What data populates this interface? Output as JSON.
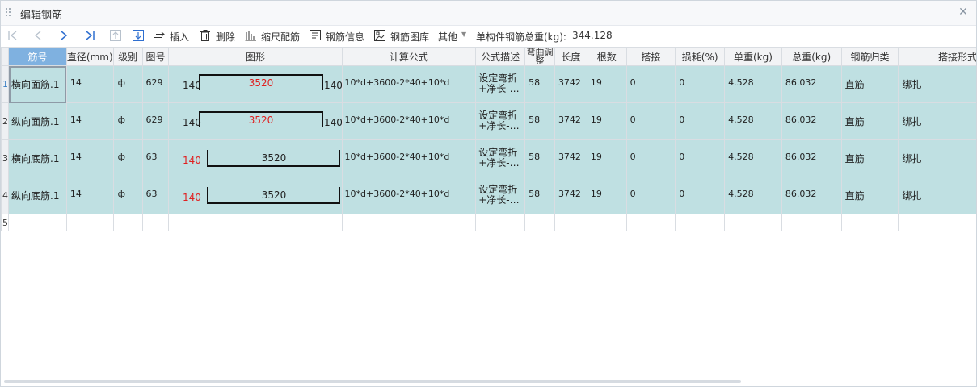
{
  "window": {
    "title": "编辑钢筋",
    "close_icon": "close-icon"
  },
  "toolbar": {
    "first_icon": "first-page-icon",
    "prev_icon": "prev-icon",
    "next_icon": "next-icon",
    "last_icon": "last-page-icon",
    "move_up_icon": "move-up-icon",
    "move_down_icon": "move-down-icon",
    "insert_label": "插入",
    "delete_label": "删除",
    "scale_label": "缩尺配筋",
    "info_label": "钢筋信息",
    "library_label": "钢筋图库",
    "other_label": "其他",
    "total_weight_label": "单构件钢筋总重(kg):",
    "total_weight_value": "344.128"
  },
  "table": {
    "headers": [
      "筋号",
      "直径(mm)",
      "级别",
      "图号",
      "图形",
      "计算公式",
      "公式描述",
      "弯曲调整",
      "长度",
      "根数",
      "搭接",
      "损耗(%)",
      "单重(kg)",
      "总重(kg)",
      "钢筋归类",
      "搭接形式"
    ],
    "rows": [
      {
        "num": "1",
        "name": "横向面筋.1",
        "diameter": "14",
        "grade": "ф",
        "fig_no": "629",
        "shape_left": "140",
        "shape_mid": "3520",
        "shape_right": "140",
        "formula": "10*d+3600-2*40+10*d",
        "desc_line1": "设定弯折",
        "desc_line2": "+净长-…",
        "bend_adj": "58",
        "length": "3742",
        "count": "19",
        "lap": "0",
        "loss": "0",
        "unit_weight": "4.528",
        "total_weight": "86.032",
        "category": "直筋",
        "lap_type": "绑扎"
      },
      {
        "num": "2",
        "name": "纵向面筋.1",
        "diameter": "14",
        "grade": "ф",
        "fig_no": "629",
        "shape_left": "140",
        "shape_mid": "3520",
        "shape_right": "140",
        "formula": "10*d+3600-2*40+10*d",
        "desc_line1": "设定弯折",
        "desc_line2": "+净长-…",
        "bend_adj": "58",
        "length": "3742",
        "count": "19",
        "lap": "0",
        "loss": "0",
        "unit_weight": "4.528",
        "total_weight": "86.032",
        "category": "直筋",
        "lap_type": "绑扎"
      },
      {
        "num": "3",
        "name": "横向底筋.1",
        "diameter": "14",
        "grade": "ф",
        "fig_no": "63",
        "shape_left": "140",
        "shape_mid": "3520",
        "shape_right": "",
        "formula": "10*d+3600-2*40+10*d",
        "desc_line1": "设定弯折",
        "desc_line2": "+净长-…",
        "bend_adj": "58",
        "length": "3742",
        "count": "19",
        "lap": "0",
        "loss": "0",
        "unit_weight": "4.528",
        "total_weight": "86.032",
        "category": "直筋",
        "lap_type": "绑扎"
      },
      {
        "num": "4",
        "name": "纵向底筋.1",
        "diameter": "14",
        "grade": "ф",
        "fig_no": "63",
        "shape_left": "140",
        "shape_mid": "3520",
        "shape_right": "",
        "formula": "10*d+3600-2*40+10*d",
        "desc_line1": "设定弯折",
        "desc_line2": "+净长-…",
        "bend_adj": "58",
        "length": "3742",
        "count": "19",
        "lap": "0",
        "loss": "0",
        "unit_weight": "4.528",
        "total_weight": "86.032",
        "category": "直筋",
        "lap_type": "绑扎"
      }
    ],
    "empty_row_num": "5"
  },
  "colors": {
    "row_bg": "#bfe0e2",
    "header_active": "#7fb1e0",
    "accent_blue": "#2f6fd0",
    "shape_red": "#e02020"
  }
}
